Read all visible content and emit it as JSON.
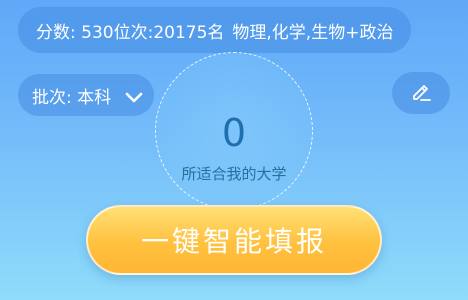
{
  "score": {
    "score_text": "分数: 530",
    "rank_text": "位次:20175名",
    "subjects_text": "物理,化学,生物+政治"
  },
  "batch": {
    "label": "批次: 本科",
    "chevron_icon": "chevron-down-icon"
  },
  "edit": {
    "icon": "pencil-edit-icon"
  },
  "match": {
    "count": "0",
    "caption": "所适合我的大学"
  },
  "cta": {
    "label": "一键智能填报"
  },
  "colors": {
    "background_top": "#5fa8f8",
    "background_bottom": "#8fdcfb",
    "cta_yellow": "#ffc13f",
    "count_blue": "#1f6fae"
  }
}
